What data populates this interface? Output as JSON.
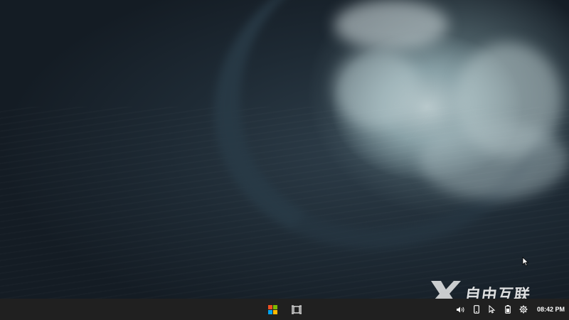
{
  "desktop": {
    "wallpaper": "ocean-wave-wallpaper"
  },
  "watermark": {
    "logo": "x-logo",
    "text": "自由互联",
    "color": "#ffffff"
  },
  "taskbar": {
    "background": "#202020",
    "center_icons": [
      {
        "name": "start-menu-icon"
      },
      {
        "name": "film-strip-icon"
      }
    ],
    "tray_icons": [
      {
        "name": "volume-icon"
      },
      {
        "name": "phone-icon"
      },
      {
        "name": "pointer-icon"
      },
      {
        "name": "battery-icon"
      },
      {
        "name": "settings-gear-icon"
      }
    ],
    "clock": "08:42 PM"
  },
  "colors": {
    "start_red": "#f25022",
    "start_green": "#7fba00",
    "start_blue": "#00a4ef",
    "start_yellow": "#ffb900"
  }
}
